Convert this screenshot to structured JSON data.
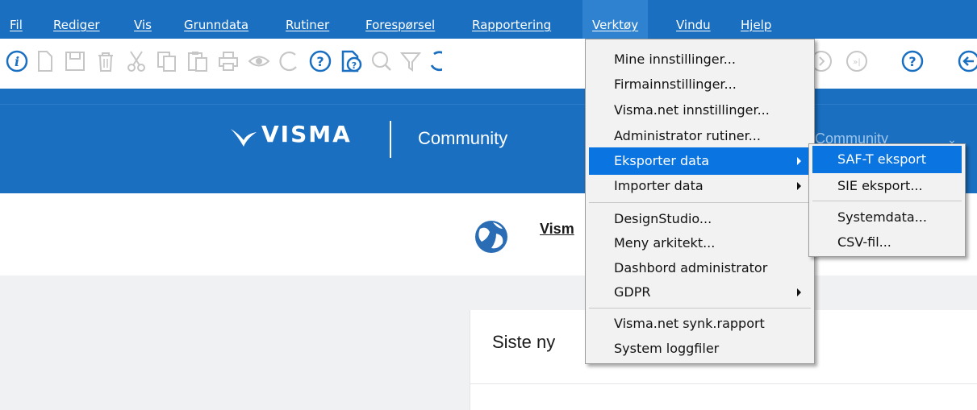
{
  "menubar": {
    "items": [
      {
        "label": "Fil"
      },
      {
        "label": "Rediger"
      },
      {
        "label": "Vis"
      },
      {
        "label": "Grunndata"
      },
      {
        "label": "Rutiner"
      },
      {
        "label": "Forespørsel"
      },
      {
        "label": "Rapportering"
      },
      {
        "label": "Verktøy"
      },
      {
        "label": "Vindu"
      },
      {
        "label": "Hjelp"
      }
    ]
  },
  "header": {
    "brand": "VISMA",
    "product": "Community",
    "selector_value": "Community"
  },
  "band": {
    "link_text": "Vism"
  },
  "card": {
    "title": "Siste ny"
  },
  "verktoy_menu": {
    "items": [
      {
        "label": "Mine innstillinger..."
      },
      {
        "label": "Firmainnstillinger..."
      },
      {
        "label": "Visma.net innstillinger..."
      },
      {
        "label": "Administrator rutiner..."
      },
      {
        "label": "Eksporter data"
      },
      {
        "label": "Importer data"
      },
      {
        "label": "DesignStudio..."
      },
      {
        "label": "Meny arkitekt..."
      },
      {
        "label": "Dashbord administrator"
      },
      {
        "label": "GDPR"
      },
      {
        "label": "Visma.net synk.rapport"
      },
      {
        "label": "System loggfiler"
      }
    ]
  },
  "eksport_submenu": {
    "items": [
      {
        "label": "SAF-T eksport"
      },
      {
        "label": "SIE eksport..."
      },
      {
        "label": "Systemdata..."
      },
      {
        "label": "CSV-fil..."
      }
    ]
  },
  "colors": {
    "brand_blue": "#1a6fc0",
    "menu_highlight": "#0a74e0",
    "icon_blue": "#1a6fc0",
    "icon_grey": "#c6c6c6"
  },
  "toolbar_icons": [
    "info-icon",
    "new-document-icon",
    "save-icon",
    "delete-icon",
    "cut-icon",
    "copy-icon",
    "paste-icon",
    "print-icon",
    "preview-icon",
    "refresh-icon",
    "help-icon",
    "help-document-icon",
    "search-icon",
    "filter-icon",
    "undo-icon",
    "next-icon",
    "last-icon",
    "question-icon",
    "back-icon"
  ]
}
